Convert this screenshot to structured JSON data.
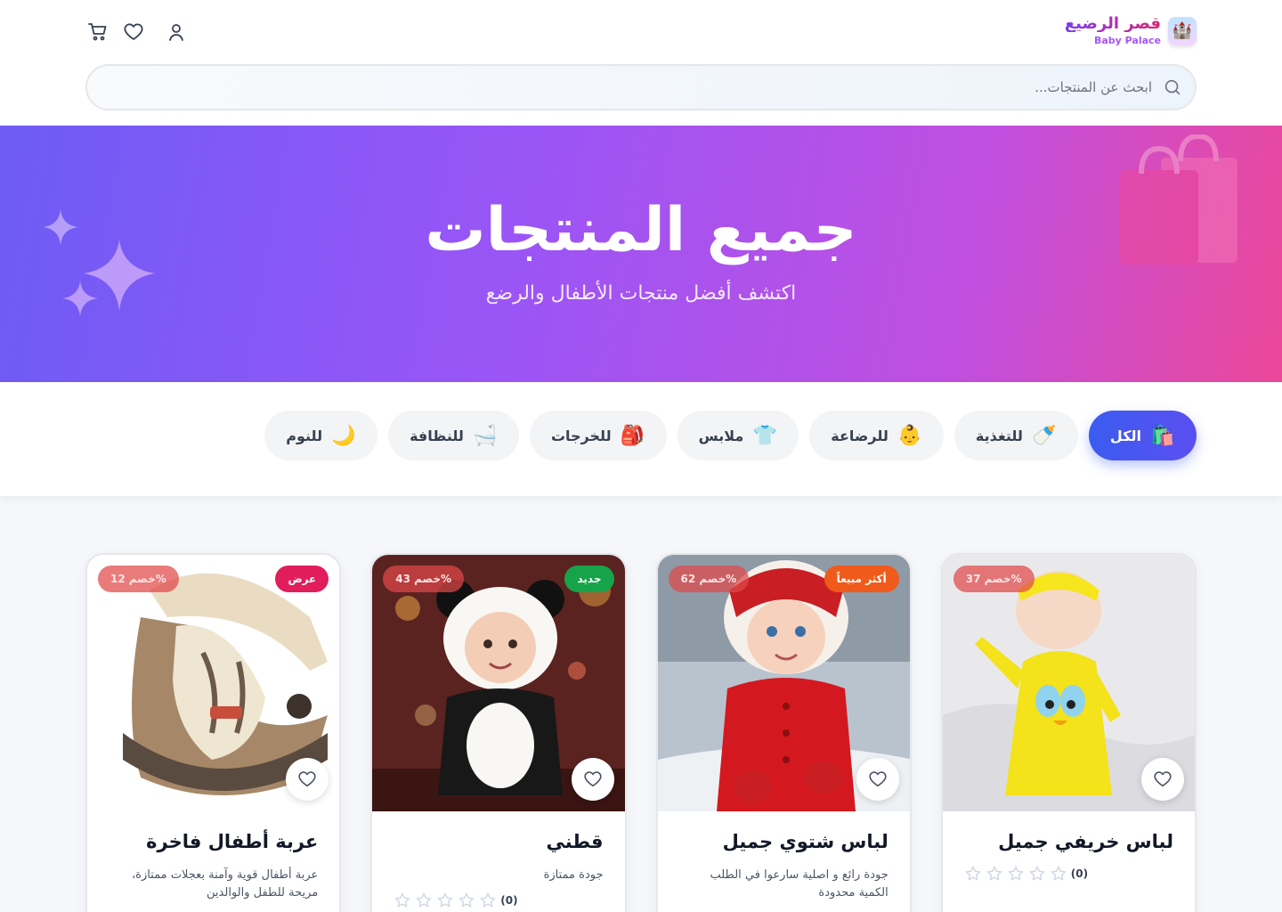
{
  "brand": {
    "name_ar": "قصر الرضيع",
    "name_en": "Baby Palace"
  },
  "search": {
    "placeholder": "ابحث عن المنتجات..."
  },
  "hero": {
    "title": "جميع المنتجات",
    "subtitle": "اكتشف أفضل منتجات الأطفال والرضع"
  },
  "categories": [
    {
      "label": "الكل",
      "icon": "shopping-bags-icon",
      "emoji": "🛍️",
      "active": true
    },
    {
      "label": "للتغذية",
      "icon": "baby-bottle-icon",
      "emoji": "🍼"
    },
    {
      "label": "للرضاعة",
      "icon": "baby-face-icon",
      "emoji": "👶"
    },
    {
      "label": "ملابس",
      "icon": "shirt-icon",
      "emoji": "👕"
    },
    {
      "label": "للخرجات",
      "icon": "backpack-icon",
      "emoji": "🎒"
    },
    {
      "label": "للنظافة",
      "icon": "bathtub-icon",
      "emoji": "🛁"
    },
    {
      "label": "للنوم",
      "icon": "moon-icon",
      "emoji": "🌙"
    }
  ],
  "products": [
    {
      "title": "لباس خريفي جميل",
      "desc": "",
      "discount": "خصم 37%",
      "tag": "",
      "tag_color": "",
      "rating_count": "(0)",
      "image": "baby-yellow-outfit"
    },
    {
      "title": "لباس شتوي جميل",
      "desc": "جودة رائع و اصلية سارعوا في الطلب الكمية محدودة",
      "discount": "خصم 62%",
      "tag": "أكثر مبيعاً",
      "tag_color": "#f05a1a",
      "rating_count": "",
      "image": "baby-red-snowsuit"
    },
    {
      "title": "قطني",
      "desc": "جودة ممتازة",
      "discount": "خصم 43%",
      "tag": "جديد",
      "tag_color": "#16a34a",
      "rating_count": "(0)",
      "image": "baby-panda-outfit"
    },
    {
      "title": "عربة أطفال فاخرة",
      "desc": "عربة أطفال قوية وآمنة بعجلات ممتازة، مريحة للطفل والوالدين",
      "discount": "خصم 12%",
      "tag": "عرض",
      "tag_color": "#e11d5c",
      "rating_count": "",
      "image": "baby-car-seat"
    }
  ]
}
